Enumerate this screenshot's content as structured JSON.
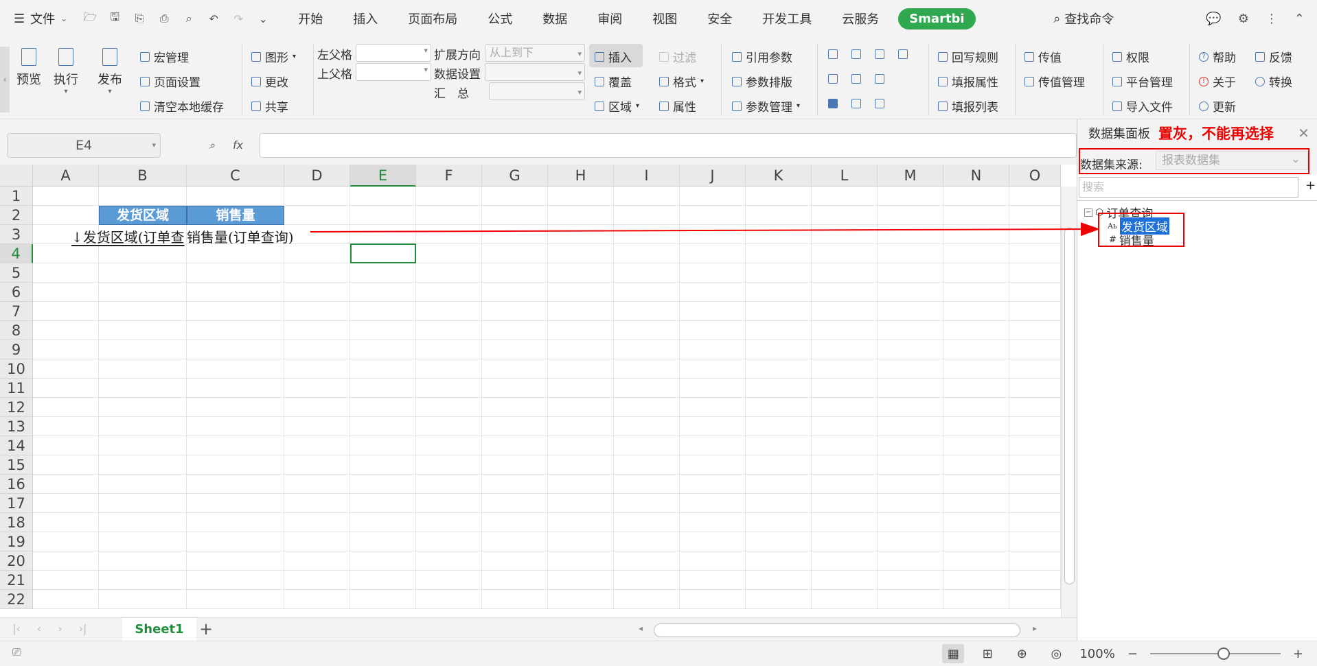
{
  "menubar": {
    "file_label": "文件",
    "tabs": [
      "开始",
      "插入",
      "页面布局",
      "公式",
      "数据",
      "审阅",
      "视图",
      "安全",
      "开发工具",
      "云服务"
    ],
    "smartbi_tab": "Smartbi",
    "search_cmd": "查找命令"
  },
  "ribbon": {
    "preview": "预览",
    "execute": "执行",
    "publish": "发布",
    "macro_manage": "宏管理",
    "page_setup": "页面设置",
    "clear_cache": "清空本地缓存",
    "chart": "图形",
    "change": "更改",
    "share": "共享",
    "left_parent": "左父格",
    "top_parent": "上父格",
    "expand_dir": "扩展方向",
    "expand_dir_value": "从上到下",
    "data_setting": "数据设置",
    "summary": "汇　总",
    "insert": "插入",
    "cover": "覆盖",
    "region": "区域",
    "filter": "过滤",
    "format": "格式",
    "property": "属性",
    "ref_param": "引用参数",
    "param_layout": "参数排版",
    "param_manage": "参数管理",
    "writeback_rule": "回写规则",
    "fill_property": "填报属性",
    "fill_list": "填报列表",
    "pass_value": "传值",
    "pass_value_manage": "传值管理",
    "permission": "权限",
    "platform_manage": "平台管理",
    "import_file": "导入文件",
    "help": "帮助",
    "about": "关于",
    "update": "更新",
    "feedback": "反馈",
    "convert": "转换"
  },
  "formula_bar": {
    "cell_ref": "E4",
    "fx": "fx",
    "value": ""
  },
  "sheet": {
    "columns": [
      "A",
      "B",
      "C",
      "D",
      "E",
      "F",
      "G",
      "H",
      "I",
      "J",
      "K",
      "L",
      "M",
      "N",
      "O"
    ],
    "rows": [
      "1",
      "2",
      "3",
      "4",
      "5",
      "6",
      "7",
      "8",
      "9",
      "10",
      "11",
      "12",
      "13",
      "14",
      "15",
      "16",
      "17",
      "18",
      "19",
      "20",
      "21",
      "22"
    ],
    "header_b2": "发货区域",
    "header_c2": "销售量",
    "field_b3": "↓发货区域(订单查",
    "field_c3": "销售量(订单查询)",
    "tab_name": "Sheet1"
  },
  "statusbar": {
    "zoom": "100%"
  },
  "panel": {
    "title": "数据集面板",
    "note": "置灰，不能再选择",
    "source_label": "数据集来源:",
    "source_value": "报表数据集",
    "search_placeholder": "搜索",
    "tree_root": "订单查询",
    "field_1": "发货区域",
    "field_2": "销售量",
    "field_1_type": "Aь",
    "field_2_type": "#"
  },
  "colors": {
    "accent_green": "#1f8d3a",
    "smartbi_green": "#2fa84f",
    "header_blue": "#5b9bd5",
    "annotation_red": "#ee0000",
    "tree_select": "#1e70d8"
  }
}
